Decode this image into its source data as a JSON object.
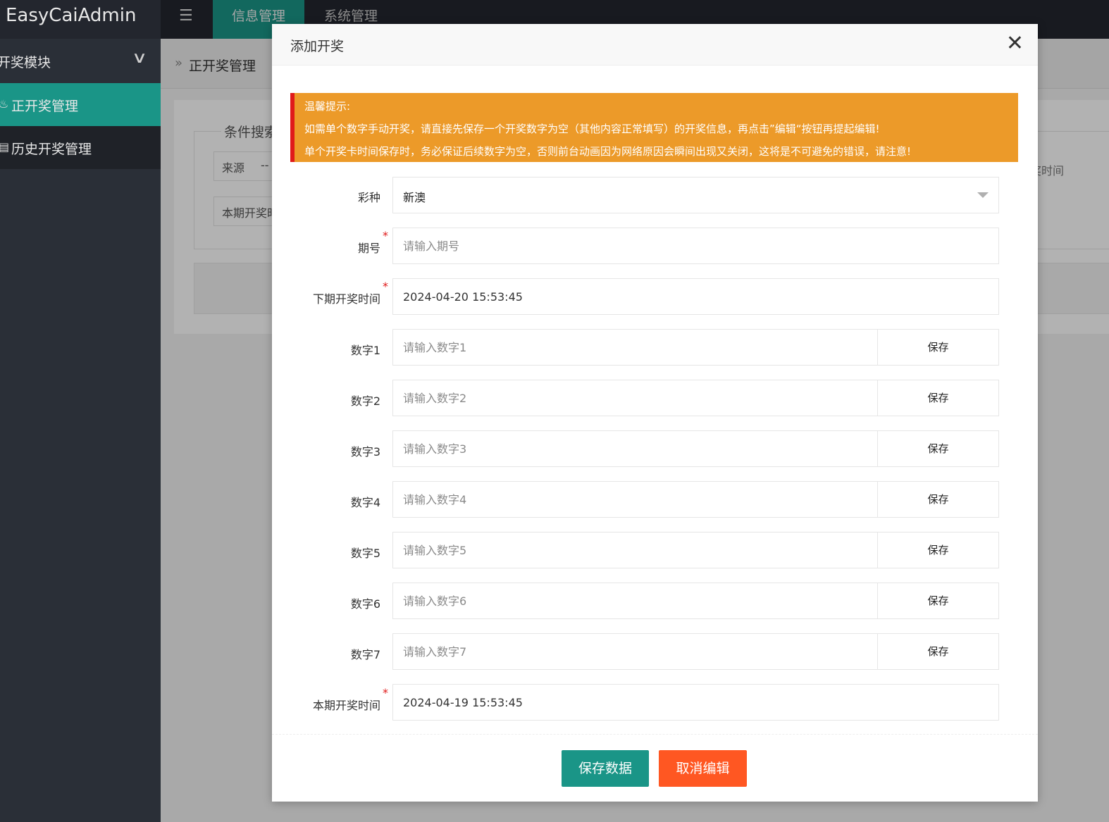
{
  "app": {
    "title": "EasyCaiAdmin"
  },
  "header": {
    "tabs": [
      {
        "label": "信息管理",
        "active": true
      },
      {
        "label": "系统管理",
        "active": false
      }
    ]
  },
  "sidebar": {
    "group_label": "开奖模块",
    "items": [
      {
        "label": "正开奖管理",
        "icon": "fire-icon",
        "active": true
      },
      {
        "label": "历史开奖管理",
        "icon": "calendar-icon",
        "active": false
      }
    ]
  },
  "breadcrumb": {
    "current": "正开奖管理"
  },
  "background": {
    "legend": "条件搜索",
    "source_label": "来源",
    "source_value": "--",
    "draw_time_label": "本期开奖时",
    "right_label": "奖时间"
  },
  "modal": {
    "title": "添加开奖",
    "close_label": "✕",
    "tip": {
      "title": "温馨提示:",
      "line1": "如需单个数字手动开奖，请直接先保存一个开奖数字为空（其他内容正常填写）的开奖信息，再点击”编辑“按钮再提起编辑!",
      "line2": "单个开奖卡时间保存时，务必保证后续数字为空，否则前台动画因为网络原因会瞬间出现又关闭，这将是不可避免的错误，请注意!"
    },
    "lottery_type": {
      "label": "彩种",
      "value": "新澳"
    },
    "period": {
      "label": "期号",
      "placeholder": "请输入期号",
      "value": ""
    },
    "next_time": {
      "label": "下期开奖时间",
      "value": "2024-04-20 15:53:45"
    },
    "numbers": [
      {
        "label": "数字1",
        "placeholder": "请输入数字1",
        "button": "保存"
      },
      {
        "label": "数字2",
        "placeholder": "请输入数字2",
        "button": "保存"
      },
      {
        "label": "数字3",
        "placeholder": "请输入数字3",
        "button": "保存"
      },
      {
        "label": "数字4",
        "placeholder": "请输入数字4",
        "button": "保存"
      },
      {
        "label": "数字5",
        "placeholder": "请输入数字5",
        "button": "保存"
      },
      {
        "label": "数字6",
        "placeholder": "请输入数字6",
        "button": "保存"
      },
      {
        "label": "数字7",
        "placeholder": "请输入数字7",
        "button": "保存"
      }
    ],
    "current_time": {
      "label": "本期开奖时间",
      "value": "2024-04-19 15:53:45"
    },
    "required_mark": "*",
    "save_button": "保存数据",
    "cancel_button": "取消编辑"
  },
  "colors": {
    "accent": "#1a9587",
    "danger": "#ff5722",
    "warning": "#ec9a29",
    "sidebar": "#2a2f37"
  }
}
